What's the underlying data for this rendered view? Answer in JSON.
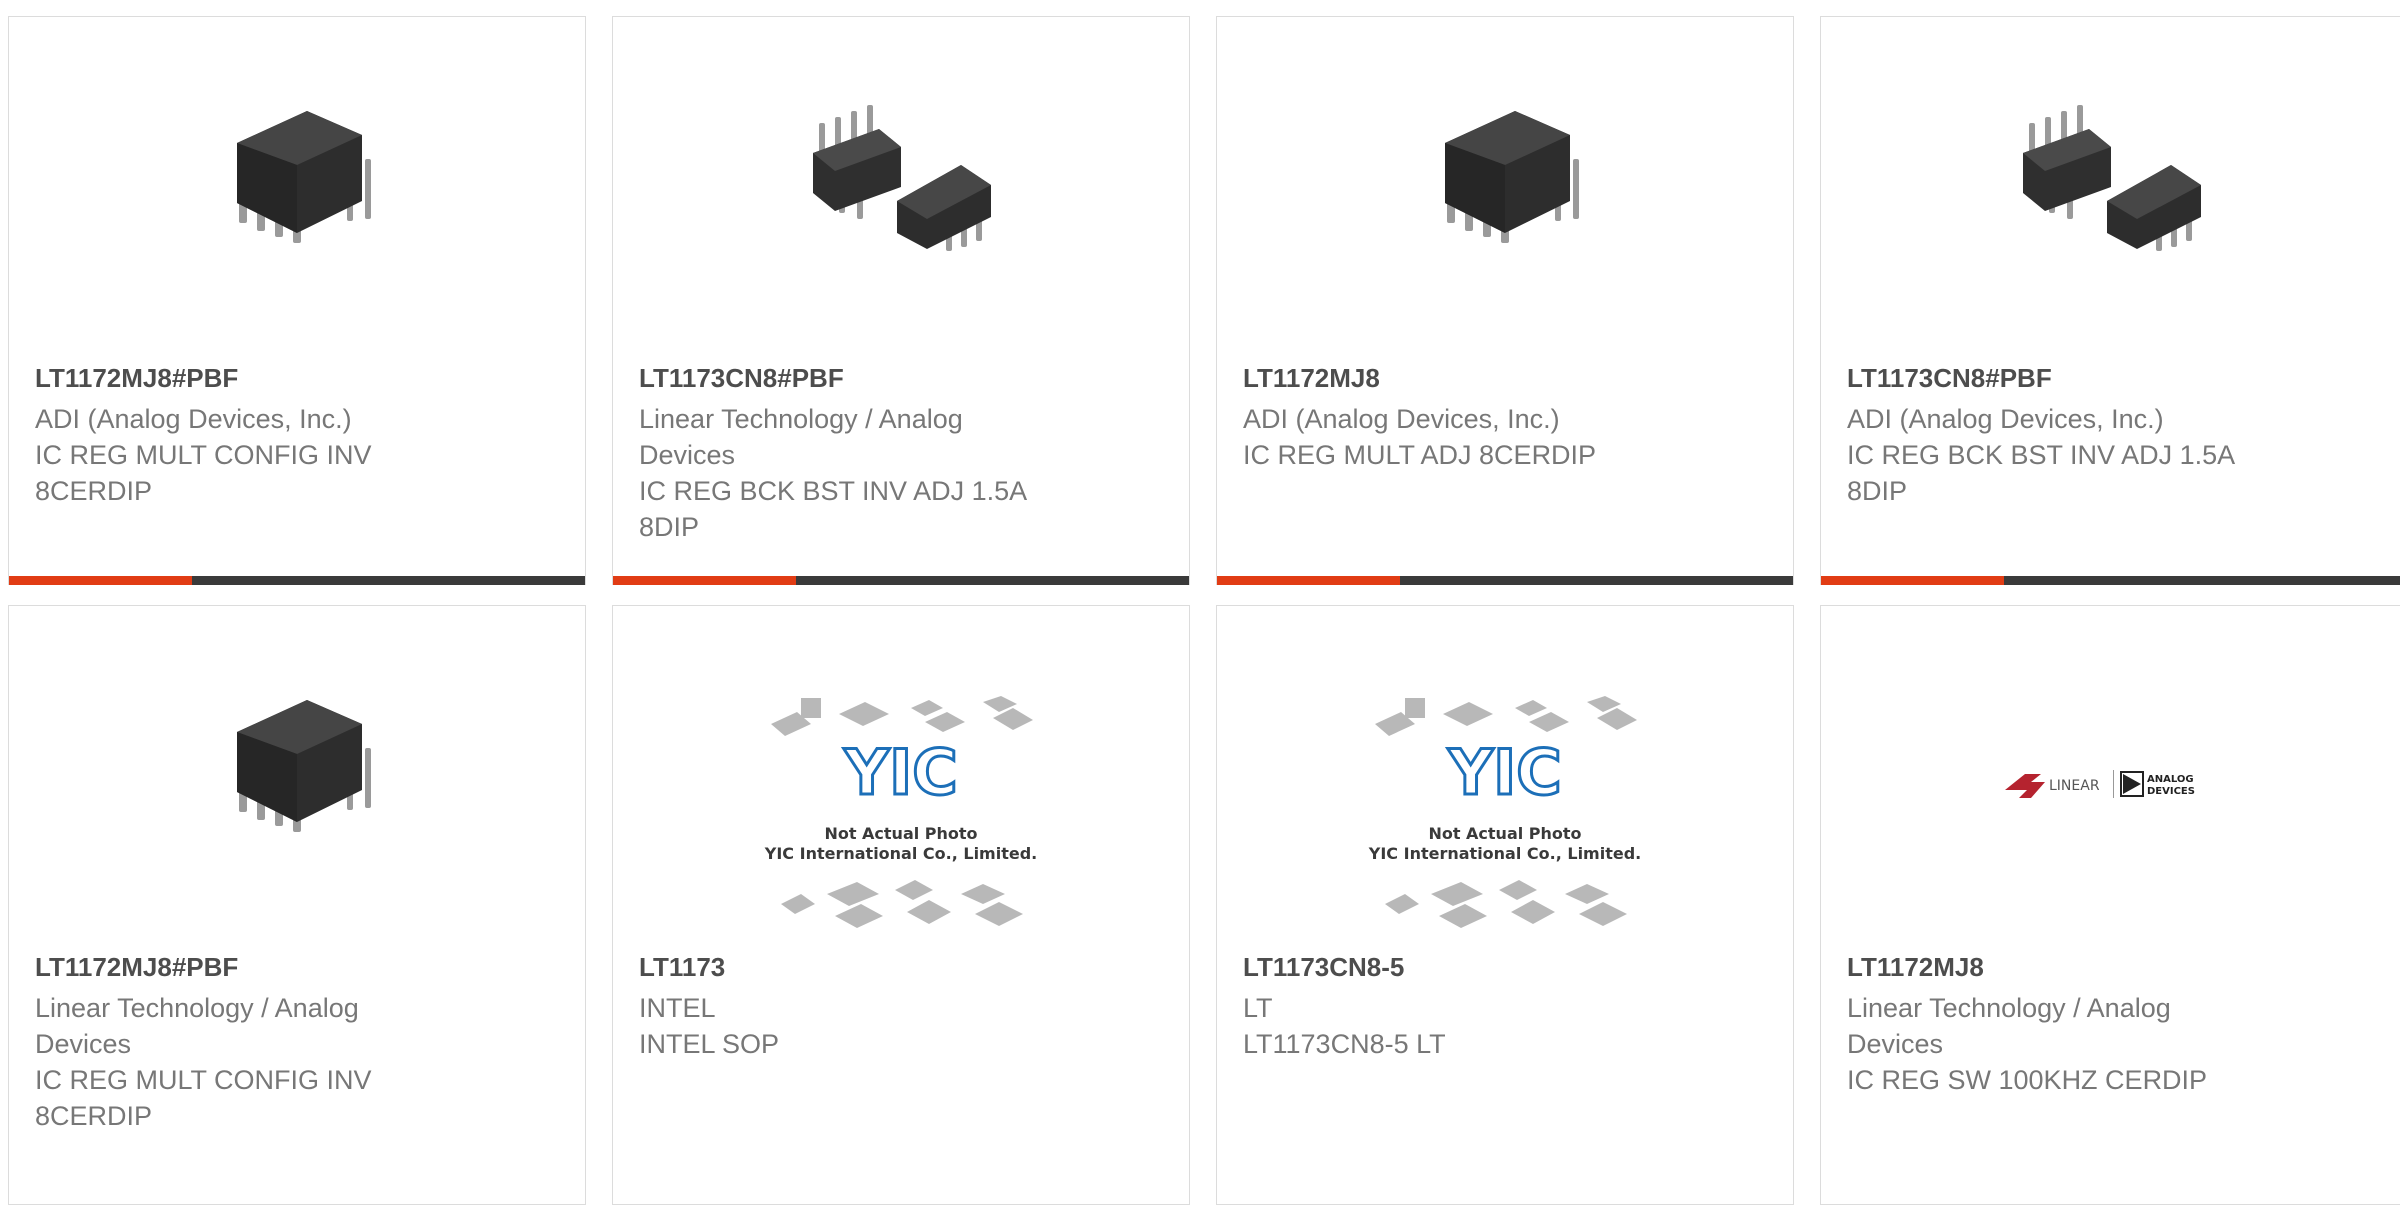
{
  "products": [
    {
      "part_number": "LT1172MJ8#PBF",
      "manufacturer": "ADI (Analog Devices, Inc.)",
      "description": "IC REG MULT CONFIG INV 8CERDIP",
      "image": "dip8-chip-icon"
    },
    {
      "part_number": "LT1173CN8#PBF",
      "manufacturer": "Linear Technology / Analog Devices",
      "description": "IC REG BCK BST INV ADJ 1.5A 8DIP",
      "image": "dip8-pair-icon"
    },
    {
      "part_number": "LT1172MJ8",
      "manufacturer": "ADI (Analog Devices, Inc.)",
      "description": "IC REG MULT ADJ 8CERDIP",
      "image": "dip8-chip-icon"
    },
    {
      "part_number": "LT1173CN8#PBF",
      "manufacturer": "ADI (Analog Devices, Inc.)",
      "description": "IC REG BCK BST INV ADJ 1.5A 8DIP",
      "image": "dip8-pair-icon"
    },
    {
      "part_number": "LT1172MJ8#PBF",
      "manufacturer": "Linear Technology / Analog Devices",
      "description": "IC REG MULT CONFIG INV 8CERDIP",
      "image": "dip8-chip-icon"
    },
    {
      "part_number": "LT1173",
      "manufacturer": "INTEL",
      "description": "INTEL SOP",
      "image": "not-actual-photo-placeholder"
    },
    {
      "part_number": "LT1173CN8-5",
      "manufacturer": "LT",
      "description": "LT1173CN8-5 LT",
      "image": "not-actual-photo-placeholder"
    },
    {
      "part_number": "LT1172MJ8",
      "manufacturer": "Linear Technology / Analog Devices",
      "description": "IC REG SW 100KHZ CERDIP",
      "image": "linear-analog-logo"
    }
  ],
  "placeholder": {
    "line1": "Not Actual Photo",
    "line2": "YIC International Co., Limited.",
    "logo": "YIC"
  },
  "colors": {
    "accent": "#e13c14",
    "bar": "#3a3a3a",
    "title": "#4d4d4d",
    "text": "#777777"
  }
}
